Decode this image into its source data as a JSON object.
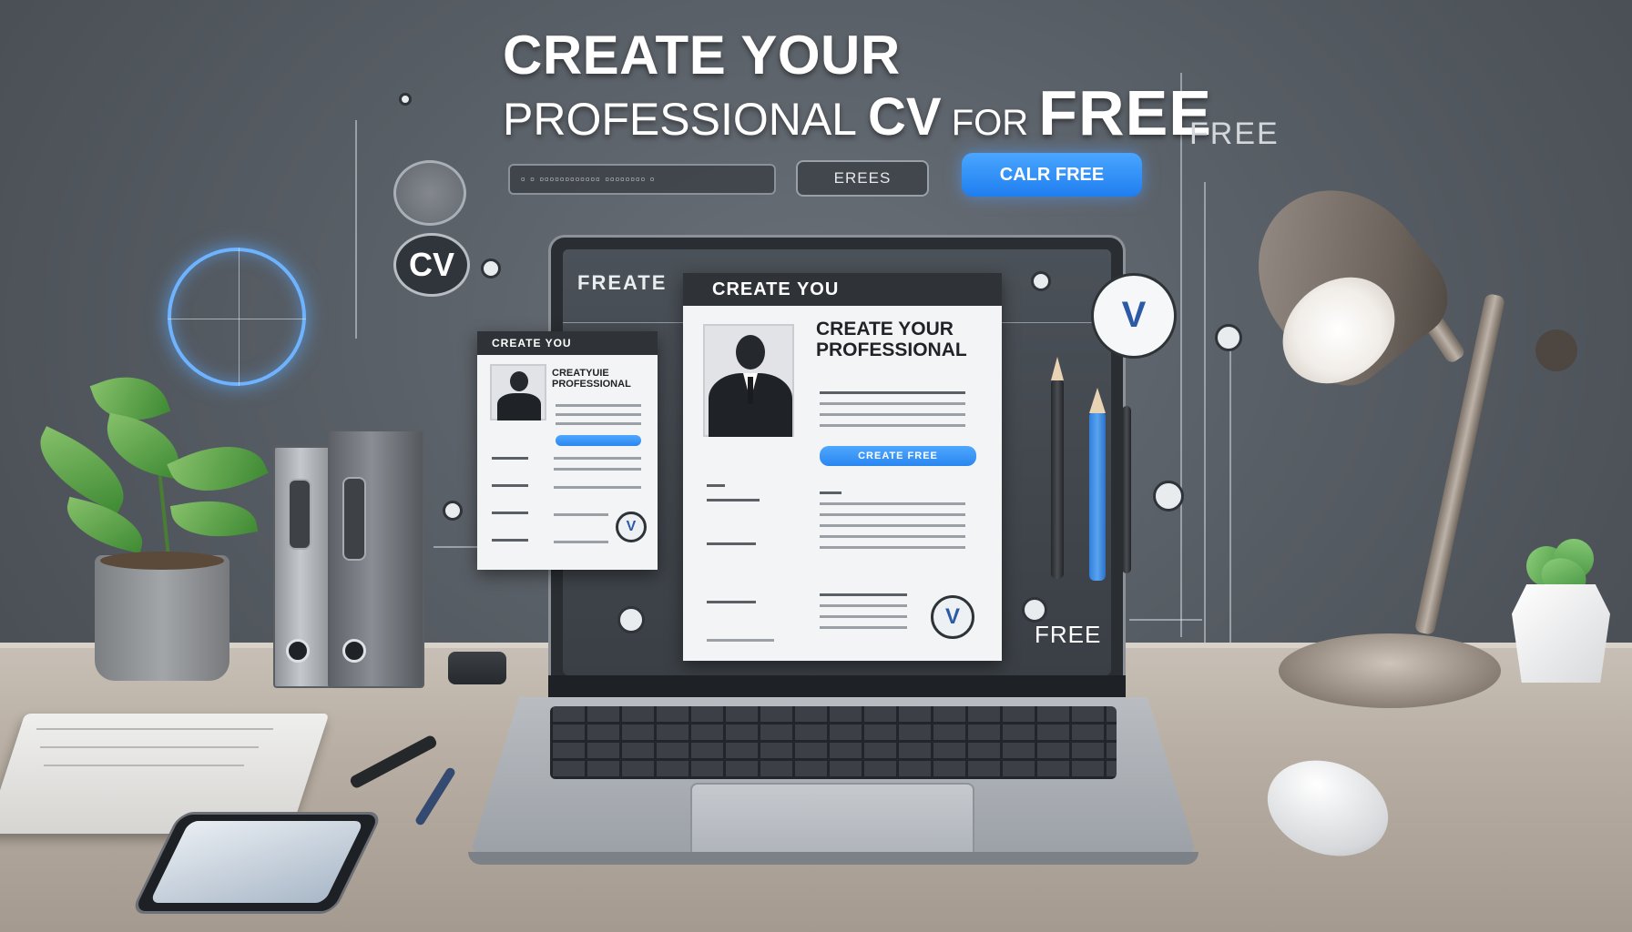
{
  "headline": {
    "line1": "CREATE YOUR",
    "line2_a": "PROFESSIONAL ",
    "line2_cv": "CV",
    "line2_for": " FOR ",
    "line2_free": "FREE"
  },
  "top_ui": {
    "url_bar_text": "▫ ▫ ▫▫▫▫▫▫▫▫▫▫▫▫ ▫▫▫▫▫▫▫▫ ▫",
    "ghost_button": "EREES",
    "cta_button": "CALR FREE"
  },
  "side_label": "FREE",
  "cv_badge": "CV",
  "screen": {
    "corner_label": "FREATE",
    "free_label": "FREE",
    "small_doc": {
      "header": "CREATE YOU",
      "title": "CREATYUIE PROFESSIONAL",
      "button": "",
      "badge": "V"
    },
    "main_doc": {
      "header": "CREATE YOU",
      "title_line1": "CREATE YOUR",
      "title_line2": "PROFESSIONAL",
      "button": "CREATE FREE",
      "badge": "V"
    },
    "round_badge": "V"
  },
  "colors": {
    "accent_blue": "#2a86f0",
    "wall": "#575d64",
    "desk": "#b7ada2"
  },
  "icons": {
    "cv_badge": "cv-circle-icon",
    "v_badge": "v-check-icon",
    "target_ring": "crosshair-ring-icon"
  }
}
